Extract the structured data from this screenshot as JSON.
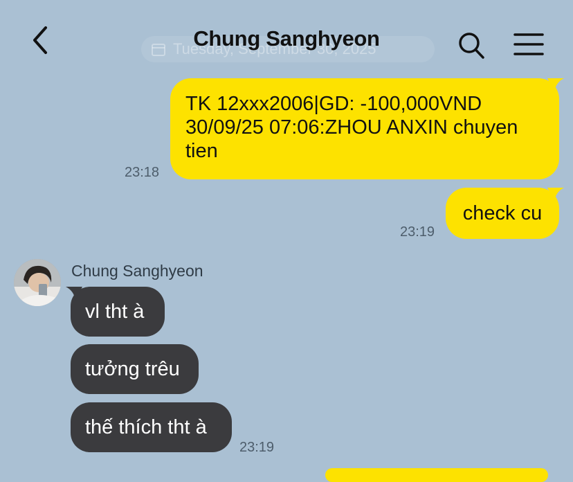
{
  "header": {
    "title": "Chung Sanghyeon",
    "date_separator": "Tuesday, September 30, 2025"
  },
  "icons": {
    "back": "chevron-left-icon",
    "search": "search-icon",
    "menu": "hamburger-menu-icon"
  },
  "colors": {
    "background": "#aac0d3",
    "outgoing_bubble": "#fde200",
    "incoming_bubble": "#3b3b3e"
  },
  "messages": [
    {
      "direction": "outgoing",
      "text": "TK 12xxx2006|GD: -100,000VND 30/09/25 07:06:ZHOU ANXIN chuyen tien",
      "time": "23:18"
    },
    {
      "direction": "outgoing",
      "text": "check cu",
      "time": "23:19"
    },
    {
      "direction": "incoming",
      "sender": "Chung Sanghyeon",
      "text": "vl tht à"
    },
    {
      "direction": "incoming",
      "text": "tưởng trêu"
    },
    {
      "direction": "incoming",
      "text": "thế thích tht à",
      "time": "23:19"
    }
  ]
}
